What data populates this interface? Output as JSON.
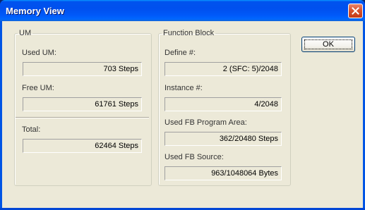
{
  "window": {
    "title": "Memory View"
  },
  "um": {
    "legend": "UM",
    "used_label": "Used UM:",
    "used_value": "703 Steps",
    "free_label": "Free UM:",
    "free_value": "61761 Steps",
    "total_label": "Total:",
    "total_value": "62464 Steps"
  },
  "function_block": {
    "legend": "Function Block",
    "define_label": "Define #:",
    "define_value": "2 (SFC: 5)/2048",
    "instance_label": "Instance #:",
    "instance_value": "4/2048",
    "program_area_label": "Used FB Program Area:",
    "program_area_value": "362/20480 Steps",
    "source_label": "Used FB Source:",
    "source_value": "963/1048064 Bytes"
  },
  "buttons": {
    "ok_label": "OK"
  },
  "icons": {
    "close": "close-icon"
  }
}
